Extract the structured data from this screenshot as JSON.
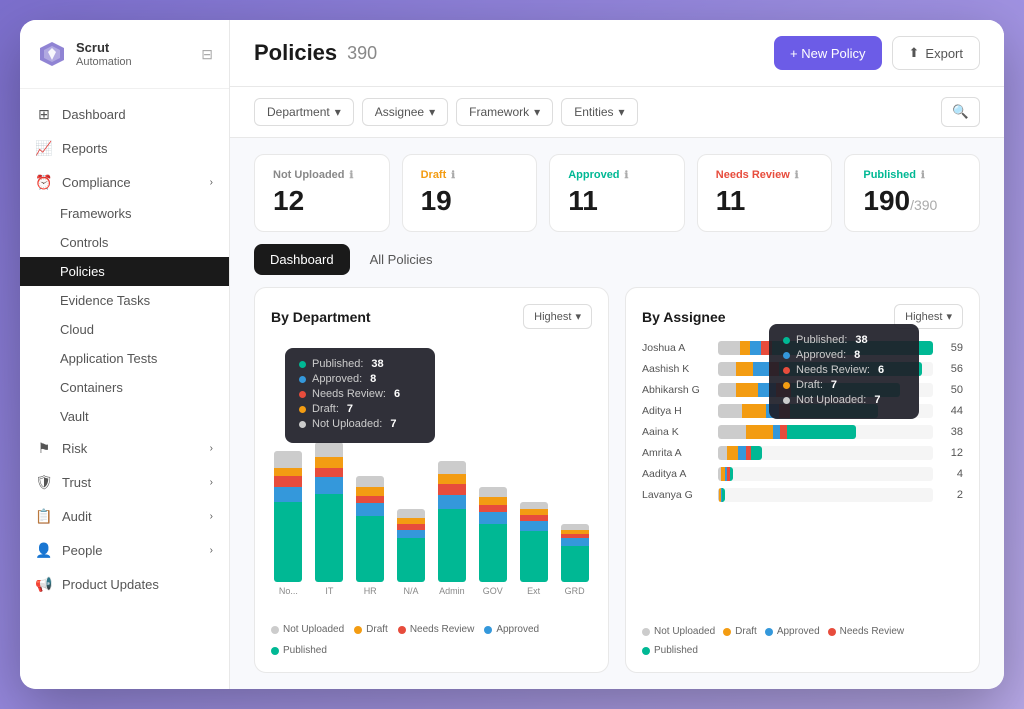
{
  "app": {
    "name": "Scrut",
    "sub": "Automation",
    "toggle_icon": "≡"
  },
  "sidebar": {
    "items": [
      {
        "id": "dashboard",
        "label": "Dashboard",
        "icon": "⊞",
        "active": false,
        "hasArrow": false
      },
      {
        "id": "reports",
        "label": "Reports",
        "icon": "📈",
        "active": false,
        "hasArrow": false
      },
      {
        "id": "compliance",
        "label": "Compliance",
        "icon": "⏰",
        "active": false,
        "hasArrow": true
      },
      {
        "id": "frameworks",
        "label": "Frameworks",
        "icon": "",
        "active": false,
        "hasArrow": false,
        "sub": true
      },
      {
        "id": "controls",
        "label": "Controls",
        "icon": "",
        "active": false,
        "hasArrow": false,
        "sub": true
      },
      {
        "id": "policies",
        "label": "Policies",
        "icon": "",
        "active": true,
        "hasArrow": false,
        "sub": true
      },
      {
        "id": "evidence-tasks",
        "label": "Evidence Tasks",
        "icon": "",
        "active": false,
        "hasArrow": false,
        "sub": true
      },
      {
        "id": "cloud",
        "label": "Cloud",
        "icon": "",
        "active": false,
        "hasArrow": false,
        "sub": true
      },
      {
        "id": "application-tests",
        "label": "Application Tests",
        "icon": "",
        "active": false,
        "hasArrow": false,
        "sub": true
      },
      {
        "id": "containers",
        "label": "Containers",
        "icon": "",
        "active": false,
        "hasArrow": false,
        "sub": true
      },
      {
        "id": "vault",
        "label": "Vault",
        "icon": "",
        "active": false,
        "hasArrow": false,
        "sub": true
      },
      {
        "id": "risk",
        "label": "Risk",
        "icon": "⚑",
        "active": false,
        "hasArrow": true
      },
      {
        "id": "trust",
        "label": "Trust",
        "icon": "🛡",
        "active": false,
        "hasArrow": true
      },
      {
        "id": "audit",
        "label": "Audit",
        "icon": "📋",
        "active": false,
        "hasArrow": true
      },
      {
        "id": "people",
        "label": "People",
        "icon": "👤",
        "active": false,
        "hasArrow": true
      },
      {
        "id": "product-updates",
        "label": "Product Updates",
        "icon": "📢",
        "active": false,
        "hasArrow": false
      }
    ]
  },
  "header": {
    "title": "Policies",
    "count": "390",
    "new_policy_label": "+ New Policy",
    "export_label": "Export"
  },
  "filters": {
    "department": "Department",
    "assignee": "Assignee",
    "framework": "Framework",
    "entities": "Entities"
  },
  "stats": [
    {
      "id": "not-uploaded",
      "label": "Not Uploaded",
      "value": "12",
      "total": null,
      "color": "#888"
    },
    {
      "id": "draft",
      "label": "Draft",
      "value": "19",
      "total": null,
      "color": "#f39c12"
    },
    {
      "id": "approved",
      "label": "Approved",
      "value": "11",
      "total": null,
      "color": "#00b894"
    },
    {
      "id": "needs-review",
      "label": "Needs Review",
      "value": "11",
      "total": null,
      "color": "#e74c3c"
    },
    {
      "id": "published",
      "label": "Published",
      "value": "190",
      "total": "/390",
      "color": "#00b894"
    }
  ],
  "tabs": [
    {
      "id": "dashboard",
      "label": "Dashboard",
      "active": true
    },
    {
      "id": "all-policies",
      "label": "All Policies",
      "active": false
    }
  ],
  "by_department": {
    "title": "By Department",
    "highest_label": "Highest",
    "bars": [
      {
        "label": "No...",
        "published": 55,
        "approved": 10,
        "needs_review": 8,
        "draft": 5,
        "not_uploaded": 12
      },
      {
        "label": "IT",
        "published": 60,
        "approved": 12,
        "needs_review": 6,
        "draft": 8,
        "not_uploaded": 10
      },
      {
        "label": "HR",
        "published": 45,
        "approved": 9,
        "needs_review": 5,
        "draft": 6,
        "not_uploaded": 8
      },
      {
        "label": "N/A",
        "published": 30,
        "approved": 6,
        "needs_review": 4,
        "draft": 4,
        "not_uploaded": 6
      },
      {
        "label": "Admin",
        "published": 50,
        "approved": 10,
        "needs_review": 7,
        "draft": 7,
        "not_uploaded": 9
      },
      {
        "label": "GOV",
        "published": 40,
        "approved": 8,
        "needs_review": 5,
        "draft": 5,
        "not_uploaded": 7
      },
      {
        "label": "Ext",
        "published": 35,
        "approved": 7,
        "needs_review": 4,
        "draft": 4,
        "not_uploaded": 5
      },
      {
        "label": "GRD",
        "published": 25,
        "approved": 5,
        "needs_review": 3,
        "draft": 3,
        "not_uploaded": 4
      }
    ],
    "tooltip": {
      "published": {
        "label": "Published:",
        "value": "38"
      },
      "approved": {
        "label": "Approved:",
        "value": "8"
      },
      "needs_review": {
        "label": "Needs Review:",
        "value": "6"
      },
      "draft": {
        "label": "Draft:",
        "value": "7"
      },
      "not_uploaded": {
        "label": "Not Uploaded:",
        "value": "7"
      }
    },
    "legend": [
      {
        "label": "Not Uploaded",
        "color": "#ccc"
      },
      {
        "label": "Draft",
        "color": "#f39c12"
      },
      {
        "label": "Needs Review",
        "color": "#e74c3c"
      },
      {
        "label": "Approved",
        "color": "#3498db"
      },
      {
        "label": "Published",
        "color": "#00b894"
      }
    ]
  },
  "by_assignee": {
    "title": "By Assignee",
    "highest_label": "Highest",
    "assignees": [
      {
        "name": "Joshua A",
        "total": 59,
        "published": 75,
        "approved": 5,
        "needs_review": 5,
        "draft": 5,
        "not_uploaded": 10
      },
      {
        "name": "Aashish K",
        "total": 56,
        "published": 70,
        "approved": 8,
        "needs_review": 5,
        "draft": 8,
        "not_uploaded": 9
      },
      {
        "name": "Abhikarsh G",
        "total": 50,
        "published": 60,
        "approved": 10,
        "needs_review": 8,
        "draft": 12,
        "not_uploaded": 10
      },
      {
        "name": "Aditya H",
        "total": 44,
        "published": 55,
        "approved": 8,
        "needs_review": 7,
        "draft": 15,
        "not_uploaded": 15
      },
      {
        "name": "Aaina K",
        "total": 38,
        "published": 50,
        "approved": 5,
        "needs_review": 5,
        "draft": 20,
        "not_uploaded": 20
      },
      {
        "name": "Amrita A",
        "total": 12,
        "published": 25,
        "approved": 20,
        "needs_review": 10,
        "draft": 25,
        "not_uploaded": 20
      },
      {
        "name": "Aaditya A",
        "total": 4,
        "published": 20,
        "approved": 20,
        "needs_review": 15,
        "draft": 25,
        "not_uploaded": 20
      },
      {
        "name": "Lavanya G",
        "total": 2,
        "published": 40,
        "approved": 15,
        "needs_review": 10,
        "draft": 20,
        "not_uploaded": 15
      }
    ],
    "tooltip": {
      "published": {
        "label": "Published:",
        "value": "38"
      },
      "approved": {
        "label": "Approved:",
        "value": "8"
      },
      "needs_review": {
        "label": "Needs Review:",
        "value": "6"
      },
      "draft": {
        "label": "Draft:",
        "value": "7"
      },
      "not_uploaded": {
        "label": "Not Uploaded:",
        "value": "7"
      }
    },
    "legend": [
      {
        "label": "Not Uploaded",
        "color": "#ccc"
      },
      {
        "label": "Draft",
        "color": "#f39c12"
      },
      {
        "label": "Approved",
        "color": "#3498db"
      },
      {
        "label": "Needs Review",
        "color": "#e74c3c"
      },
      {
        "label": "Published",
        "color": "#00b894"
      }
    ]
  },
  "colors": {
    "published": "#00b894",
    "approved": "#3498db",
    "needs_review": "#e74c3c",
    "draft": "#f39c12",
    "not_uploaded": "#ccc",
    "active_nav": "#1a1a1a",
    "accent": "#6c5ce7"
  }
}
